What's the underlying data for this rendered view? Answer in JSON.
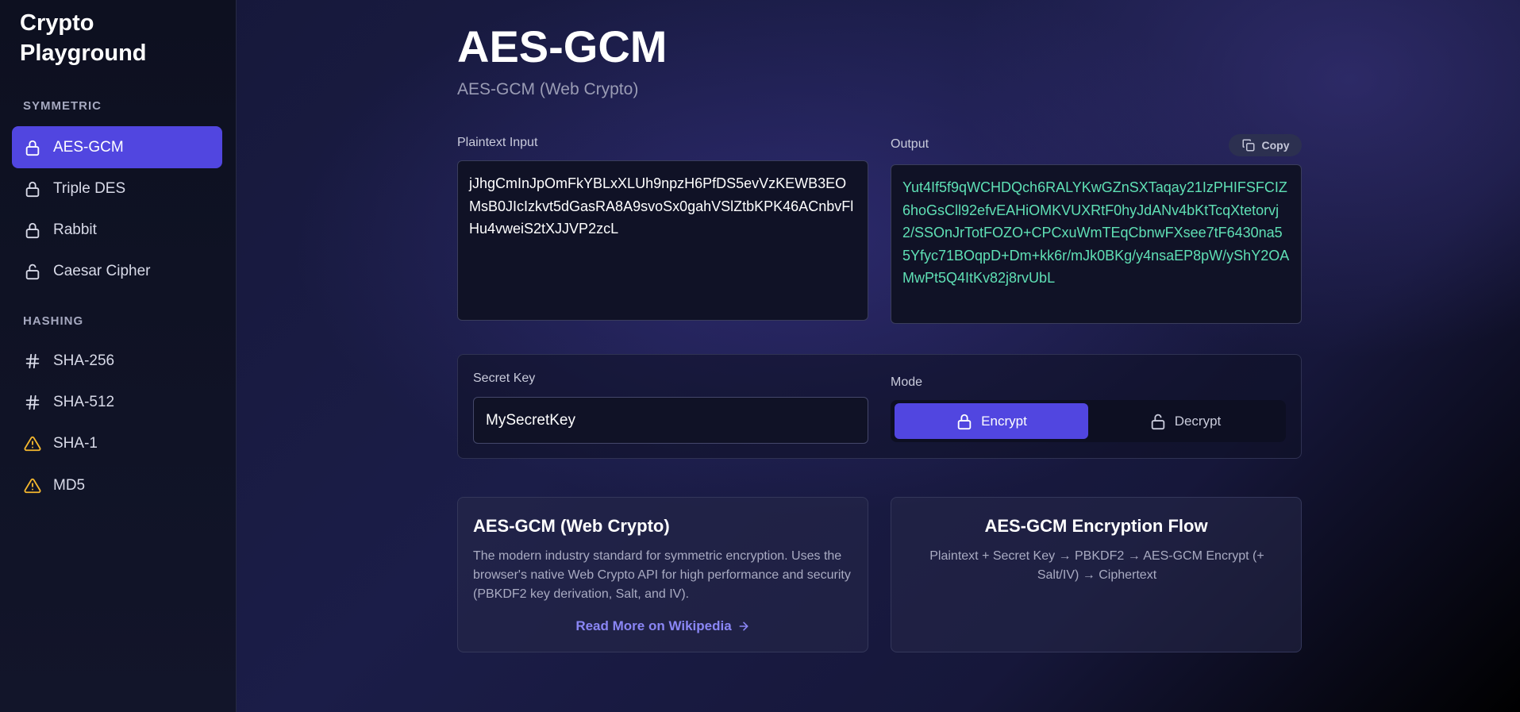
{
  "sidebar": {
    "app_title": "Crypto Playground",
    "sections": [
      {
        "label": "SYMMETRIC",
        "items": [
          {
            "label": "AES-GCM",
            "icon": "lock-icon",
            "active": true
          },
          {
            "label": "Triple DES",
            "icon": "lock-icon"
          },
          {
            "label": "Rabbit",
            "icon": "lock-icon"
          },
          {
            "label": "Caesar Cipher",
            "icon": "unlock-icon"
          }
        ]
      },
      {
        "label": "HASHING",
        "items": [
          {
            "label": "SHA-256",
            "icon": "hash-icon"
          },
          {
            "label": "SHA-512",
            "icon": "hash-icon"
          },
          {
            "label": "SHA-1",
            "icon": "warning-icon"
          },
          {
            "label": "MD5",
            "icon": "warning-icon"
          }
        ]
      }
    ]
  },
  "main": {
    "title": "AES-GCM",
    "subtitle": "AES-GCM (Web Crypto)",
    "plaintext": {
      "label": "Plaintext Input",
      "value": "jJhgCmInJpOmFkYBLxXLUh9npzH6PfDS5evVzKEWB3EOMsB0JIcIzkvt5dGasRA8A9svoSx0gahVSlZtbKPK46ACnbvFlHu4vweiS2tXJJVP2zcL"
    },
    "output": {
      "label": "Output",
      "copy_label": "Copy",
      "value": "Yut4If5f9qWCHDQch6RALYKwGZnSXTaqay21IzPHIFSFCIZ6hoGsCll92efvEAHiOMKVUXRtF0hyJdANv4bKtTcqXtetorvj2/SSOnJrTotFOZO+CPCxuWmTEqCbnwFXsee7tF6430na55Yfyc71BOqpD+Dm+kk6r/mJk0BKg/y4nsaEP8pW/yShY2OAMwPt5Q4ItKv82j8rvUbL"
    },
    "secret_key": {
      "label": "Secret Key",
      "value": "MySecretKey"
    },
    "mode": {
      "label": "Mode",
      "encrypt_label": "Encrypt",
      "decrypt_label": "Decrypt",
      "selected": "Encrypt"
    },
    "info_card": {
      "title": "AES-GCM (Web Crypto)",
      "description": "The modern industry standard for symmetric encryption. Uses the browser's native Web Crypto API for high performance and security (PBKDF2 key derivation, Salt, and IV).",
      "link_label": "Read More on Wikipedia"
    },
    "flow_card": {
      "title": "AES-GCM Encryption Flow",
      "description": "Plaintext + Secret Key → PBKDF2 → AES-GCM Encrypt (+ Salt/IV) → Ciphertext"
    }
  },
  "colors": {
    "accent": "#5146e0",
    "output_text": "#5fe0b5",
    "warning": "#f5b82e",
    "link": "#8a86f5"
  }
}
